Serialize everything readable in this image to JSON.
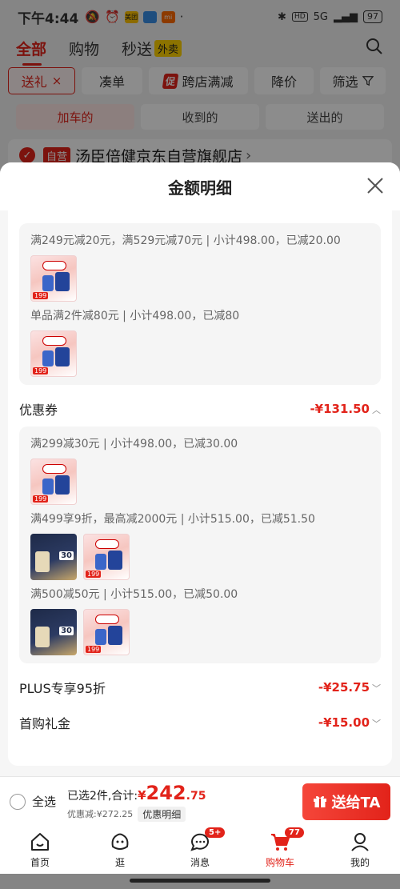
{
  "status_bar": {
    "time": "下午4:44",
    "battery": "97",
    "network": "5G",
    "hd": "HD",
    "app_badges": [
      {
        "name": "meituan-badge",
        "text": "美团",
        "color": "#ffc300"
      },
      {
        "name": "card-badge",
        "text": "",
        "color": "#3a8ee6"
      },
      {
        "name": "mi-badge",
        "text": "mi",
        "color": "#ff6a00"
      }
    ]
  },
  "top_tabs": {
    "all": "全部",
    "shopping": "购物",
    "flash": "秒送",
    "waimai": "外卖"
  },
  "filters": {
    "gift": "送礼",
    "gift_close": "×",
    "couhdan": "凑单",
    "cu_badge": "促",
    "cross_store": "跨店满减",
    "price_drop": "降价",
    "filter": "筛选"
  },
  "sub_tabs": [
    "加车的",
    "收到的",
    "送出的"
  ],
  "store": {
    "badge": "自营",
    "name": "汤臣倍健京东自营旗舰店",
    "arrow": "›"
  },
  "sheet": {
    "title": "金额明细",
    "group1": {
      "rule1": "满249元减20元，满529元减70元 | 小计498.00，已减20.00",
      "rule2": "单品满2件减80元 | 小计498.00，已减80"
    },
    "coupon": {
      "label": "优惠券",
      "amount": "-¥131.50",
      "chevron": "︿"
    },
    "group2": {
      "rule1": "满299减30元 | 小计498.00，已减30.00",
      "rule2": "满499享9折，最高减2000元 | 小计515.00，已减51.50",
      "rule3": "满500减50元 | 小计515.00，已减50.00"
    },
    "plus": {
      "label": "PLUS专享95折",
      "amount": "-¥25.75",
      "chevron": "﹀"
    },
    "first_gift": {
      "label": "首购礼金",
      "amount": "-¥15.00",
      "chevron": "﹀"
    }
  },
  "thumb_labels": {
    "price_tag": "199",
    "number": "30"
  },
  "checkout": {
    "select_all": "全选",
    "selected_prefix": "已选2件,合计:",
    "yen": "¥",
    "total_int": "242",
    "total_dec": ".75",
    "discount_text": "优惠减:¥272.25",
    "detail_button": "优惠明细",
    "give_button": "送给TA"
  },
  "nav": {
    "home": "首页",
    "browse": "逛",
    "messages": "消息",
    "messages_badge": "5+",
    "cart": "购物车",
    "cart_badge": "77",
    "me": "我的"
  },
  "colors": {
    "accent": "#e2231a"
  }
}
